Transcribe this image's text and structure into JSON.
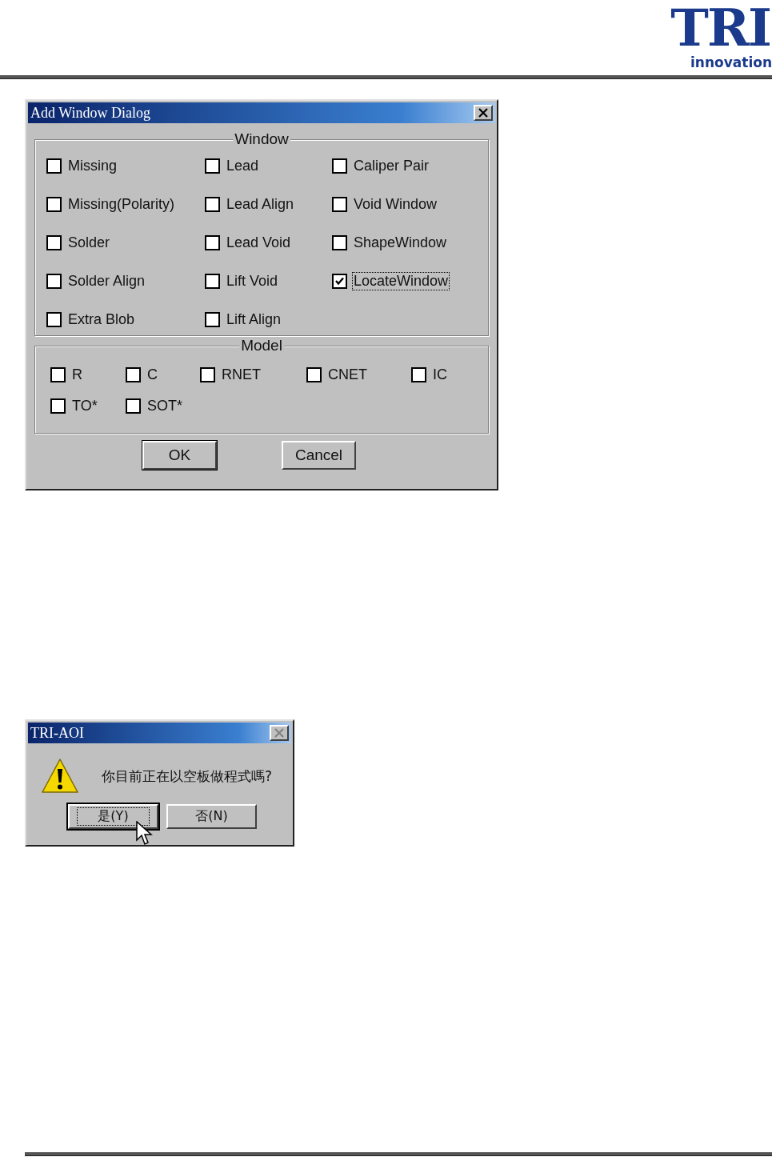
{
  "header": {
    "logo": {
      "mark": "TRI",
      "tagline": "innovation"
    }
  },
  "add_window_dialog": {
    "title": "Add Window Dialog",
    "window_group": {
      "label": "Window",
      "options": [
        {
          "label": "Missing",
          "checked": false,
          "focused": false
        },
        {
          "label": "Lead",
          "checked": false,
          "focused": false
        },
        {
          "label": "Caliper Pair",
          "checked": false,
          "focused": false
        },
        {
          "label": "Missing(Polarity)",
          "checked": false,
          "focused": false
        },
        {
          "label": "Lead Align",
          "checked": false,
          "focused": false
        },
        {
          "label": "Void Window",
          "checked": false,
          "focused": false
        },
        {
          "label": "Solder",
          "checked": false,
          "focused": false
        },
        {
          "label": "Lead Void",
          "checked": false,
          "focused": false
        },
        {
          "label": "ShapeWindow",
          "checked": false,
          "focused": false
        },
        {
          "label": "Solder Align",
          "checked": false,
          "focused": false
        },
        {
          "label": "Lift Void",
          "checked": false,
          "focused": false
        },
        {
          "label": "LocateWindow",
          "checked": true,
          "focused": true
        },
        {
          "label": "Extra Blob",
          "checked": false,
          "focused": false
        },
        {
          "label": "Lift Align",
          "checked": false,
          "focused": false
        }
      ]
    },
    "model_group": {
      "label": "Model",
      "options": [
        {
          "label": "R",
          "checked": false
        },
        {
          "label": "C",
          "checked": false
        },
        {
          "label": "RNET",
          "checked": false
        },
        {
          "label": "CNET",
          "checked": false
        },
        {
          "label": "IC",
          "checked": false
        },
        {
          "label": "TO*",
          "checked": false
        },
        {
          "label": "SOT*",
          "checked": false
        }
      ]
    },
    "buttons": [
      {
        "label": "OK",
        "default": true
      },
      {
        "label": "Cancel",
        "default": false
      }
    ]
  },
  "message_dialog": {
    "title": "TRI-AOI",
    "close_disabled": true,
    "message": "你目前正在以空板做程式嗎?",
    "buttons": [
      {
        "label": "是(Y)",
        "default": true
      },
      {
        "label": "否(N)",
        "default": false
      }
    ]
  }
}
